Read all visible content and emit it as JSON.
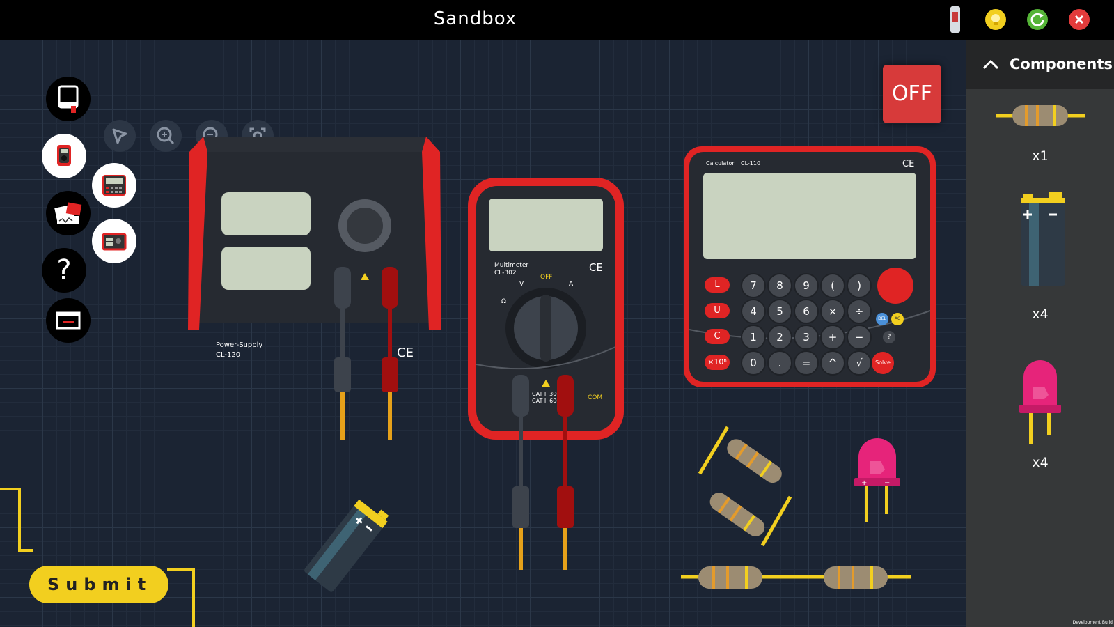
{
  "window": {
    "title": "Sandbox",
    "icons": [
      "tool-icon",
      "hint-bulb-icon",
      "restart-icon",
      "close-icon"
    ]
  },
  "toolbar": {
    "tools": [
      "notebook-icon",
      "pointer-icon",
      "zoom-in-icon",
      "zoom-out-icon",
      "fit-view-icon"
    ]
  },
  "side_menu": {
    "items": [
      "multimeter-icon",
      "calculator-icon",
      "oscilloscope-icon",
      "power-supply-icon",
      "help-icon",
      "display-icon"
    ],
    "help_label": "?"
  },
  "power_button": {
    "label": "OFF"
  },
  "submit_button": {
    "label": "Submit"
  },
  "power_supply": {
    "model": "Power-Supply",
    "code": "CL-120",
    "mark": "CE"
  },
  "multimeter": {
    "model": "Multimeter",
    "code": "CL-302",
    "off": "OFF",
    "v": "V",
    "a": "A",
    "ohm": "Ω",
    "com": "COM",
    "cat1": "CAT II 300V",
    "cat2": "CAT II 600V",
    "mark": "CE"
  },
  "calculator": {
    "model": "Calculator",
    "code": "CL-110",
    "mark": "CE",
    "mode_keys": [
      "L",
      "U",
      "C",
      "×10ⁿ"
    ],
    "keys": [
      [
        "7",
        "8",
        "9",
        "(",
        ")"
      ],
      [
        "4",
        "5",
        "6",
        "×",
        "÷"
      ],
      [
        "1",
        "2",
        "3",
        "+",
        "−"
      ],
      [
        "0",
        ".",
        "=",
        "^",
        "√"
      ]
    ],
    "del": "DEL",
    "ac": "AC",
    "help": "?",
    "solve": "Solve"
  },
  "components_panel": {
    "title": "Components",
    "items": [
      {
        "name": "resistor",
        "count": "x1"
      },
      {
        "name": "battery",
        "count": "x4"
      },
      {
        "name": "led",
        "count": "x4"
      }
    ]
  },
  "footer": {
    "build": "Development Build"
  },
  "colors": {
    "accent_red": "#e02424",
    "wire_yellow": "#f2cf1f",
    "grid": "#1b2433"
  }
}
